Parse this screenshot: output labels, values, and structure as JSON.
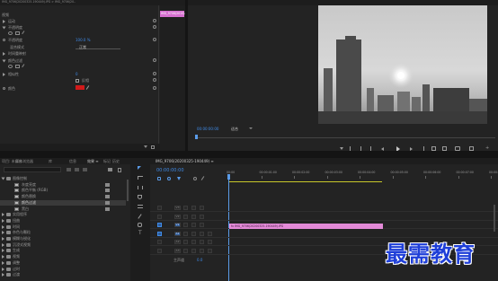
{
  "effect_controls": {
    "top_tab_text": "源:(无剪辑)  效果控件 ≡  音频剪辑混合器:IMG_9706(1)  元数据",
    "clip_label": "IMG_9706(2015)..",
    "path_text": "IMG_9706(20200325-190449).IPG > IMG_9706(20..",
    "section_label": "视频",
    "rows": [
      {
        "label": "运动",
        "value": ""
      },
      {
        "label": "不透明度",
        "value": ""
      },
      {
        "label": "不透明度",
        "value": "100.0 %"
      },
      {
        "label": "混合模式",
        "value": "正常"
      },
      {
        "label": "时间重映射",
        "value": ""
      },
      {
        "label": "颜色过滤",
        "value": ""
      },
      {
        "label": "相似性",
        "value": "0"
      },
      {
        "label": "",
        "value": "反相"
      },
      {
        "label": "颜色",
        "value": ""
      }
    ],
    "mini_clip_label": "IMG_9706(20"
  },
  "program_monitor": {
    "timecode": "00:00:00:00",
    "fit_label": "适合",
    "transport_buttons": [
      "marker",
      "in",
      "out",
      "go-in",
      "step-back",
      "play",
      "step-forward",
      "go-out",
      "insert",
      "overwrite",
      "export-frame",
      "button-editor",
      "add"
    ]
  },
  "project_panel": {
    "tabs": [
      "项目: 未命名",
      "媒体浏览器",
      "库",
      "信息",
      "效果 ≡",
      "标记",
      "历史"
    ],
    "search_placeholder": "",
    "tree": [
      {
        "label": "图像控制",
        "indent": 0,
        "type": "folder-open"
      },
      {
        "label": "灰度亮度",
        "indent": 1,
        "type": "effect"
      },
      {
        "label": "颜色平衡 (RGB)",
        "indent": 1,
        "type": "effect"
      },
      {
        "label": "颜色替换",
        "indent": 1,
        "type": "effect"
      },
      {
        "label": "颜色过滤",
        "indent": 1,
        "type": "effect",
        "selected": true
      },
      {
        "label": "黑白",
        "indent": 1,
        "type": "effect"
      },
      {
        "label": "实用程序",
        "indent": 0,
        "type": "folder"
      },
      {
        "label": "扭曲",
        "indent": 0,
        "type": "folder"
      },
      {
        "label": "时间",
        "indent": 0,
        "type": "folder"
      },
      {
        "label": "杂色与颗粒",
        "indent": 0,
        "type": "folder"
      },
      {
        "label": "模糊与锐化",
        "indent": 0,
        "type": "folder"
      },
      {
        "label": "沉浸式视频",
        "indent": 0,
        "type": "folder"
      },
      {
        "label": "生成",
        "indent": 0,
        "type": "folder"
      },
      {
        "label": "视频",
        "indent": 0,
        "type": "folder"
      },
      {
        "label": "调整",
        "indent": 0,
        "type": "folder"
      },
      {
        "label": "过时",
        "indent": 0,
        "type": "folder"
      },
      {
        "label": "过渡",
        "indent": 0,
        "type": "folder"
      }
    ]
  },
  "timeline": {
    "tab_text": "IMG_9706(20200325-190449) ≡",
    "timecode": "00:00:00:00",
    "ruler": [
      "00:00",
      "00:00:01:00",
      "00:00:02:00",
      "00:00:03:00",
      "00:00:04:00",
      "00:00:05:00",
      "00:00:06:00",
      "00:00:07:00",
      "00:00:08:00"
    ],
    "tracks": [
      {
        "name": "V3"
      },
      {
        "name": "V2"
      },
      {
        "name": "V1"
      },
      {
        "name": "A1"
      },
      {
        "name": "A2"
      },
      {
        "name": "A3"
      }
    ],
    "master_label": "主声道",
    "master_value": "0.0",
    "clip_label": "fx IMG_9706(20200325-190449).IPG"
  },
  "watermark": "最需教育",
  "colors": {
    "accent_blue": "#3f8be8",
    "clip_pink": "#e48ad8",
    "label_tab_pink": "#d66fd0",
    "red_swatch": "#d21a1a",
    "work_area_yellow": "#c8c82a",
    "playhead_blue": "#5a9be8"
  }
}
